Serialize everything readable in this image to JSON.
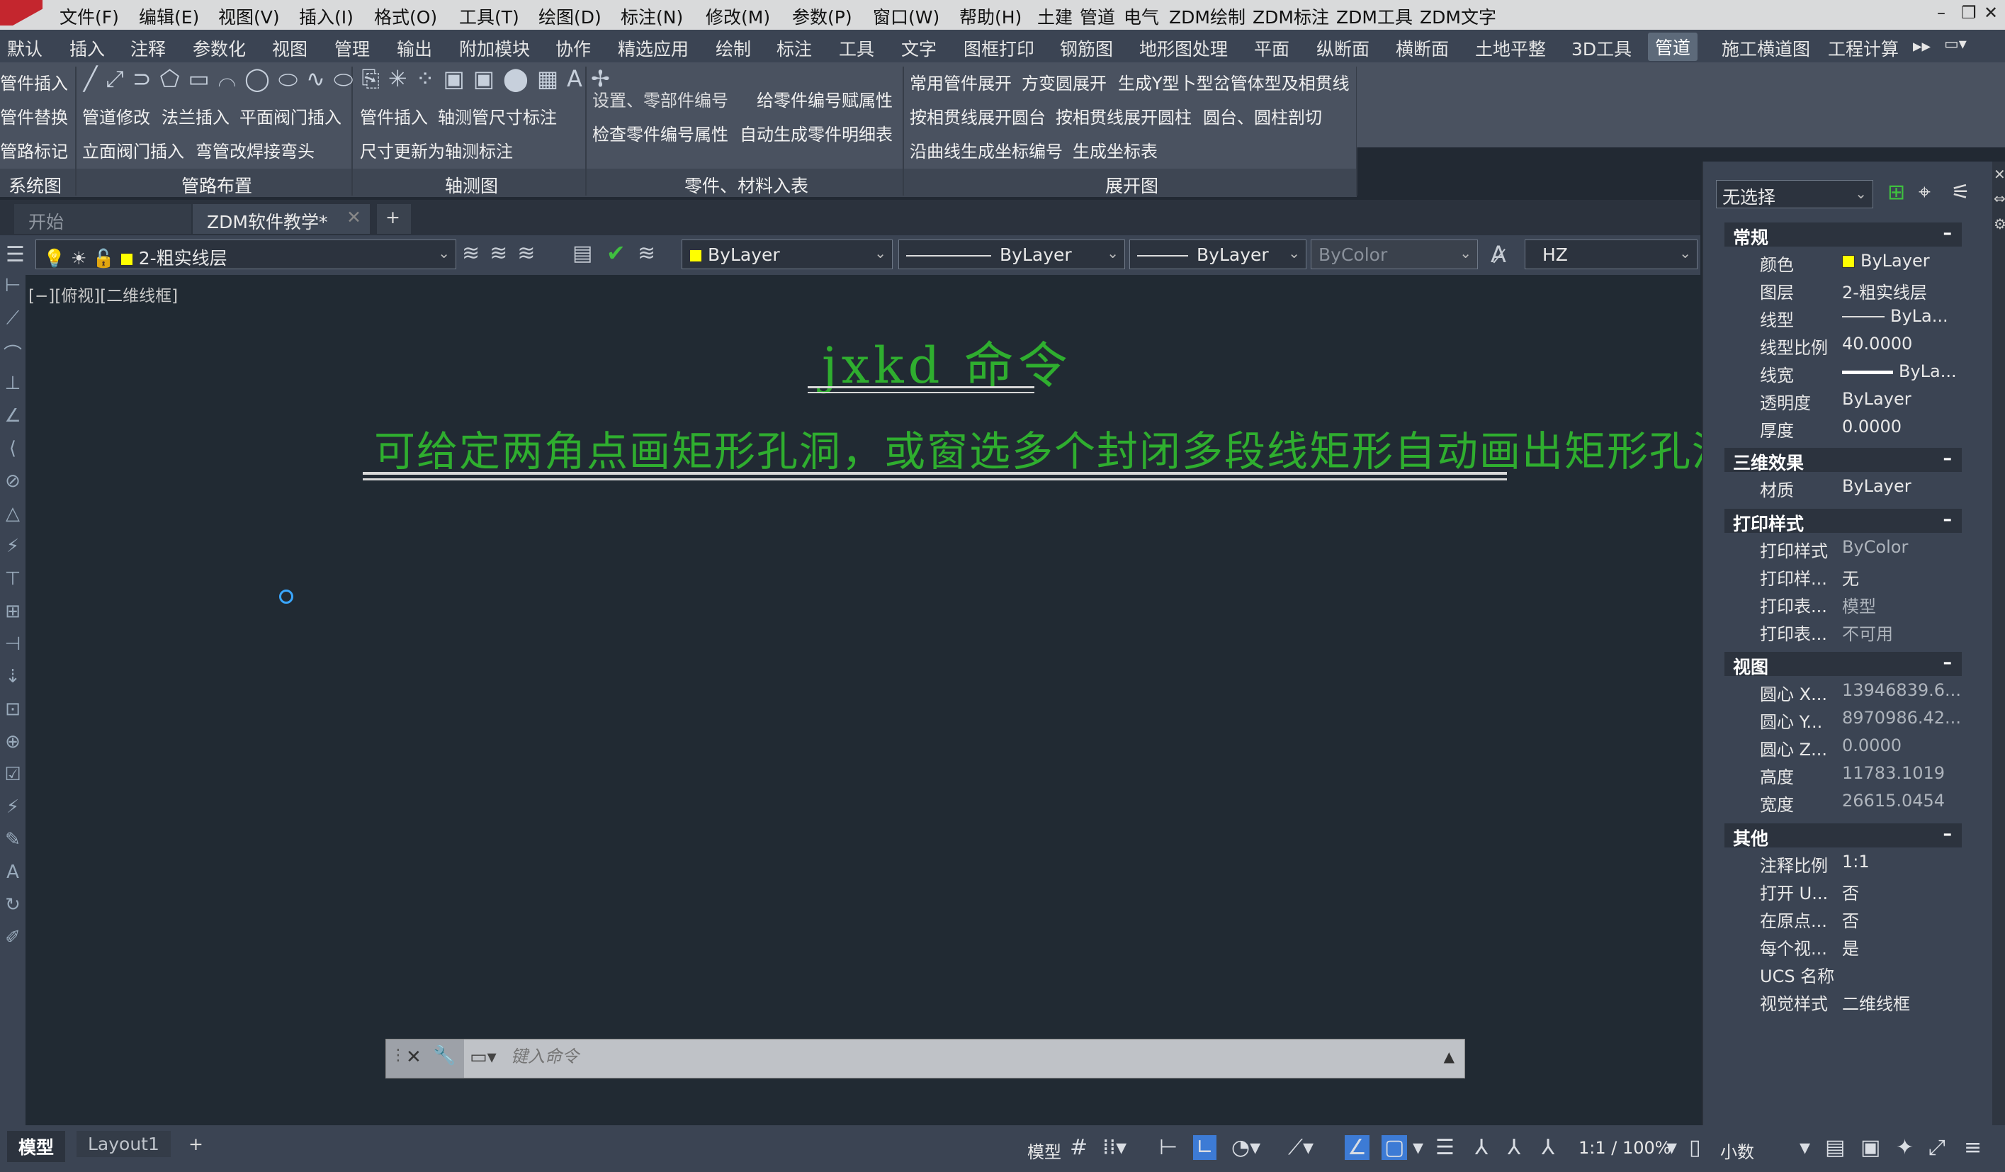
{
  "menubar": {
    "items": [
      "文件(F)",
      "编辑(E)",
      "视图(V)",
      "插入(I)",
      "格式(O)",
      "工具(T)",
      "绘图(D)",
      "标注(N)",
      "修改(M)",
      "参数(P)",
      "窗口(W)",
      "帮助(H)",
      "土建",
      "管道",
      "电气",
      "ZDM绘制",
      "ZDM标注",
      "ZDM工具",
      "ZDM文字"
    ],
    "window_controls": [
      "–",
      "❐",
      "✕"
    ]
  },
  "ribbon_tabs": {
    "items": [
      "默认",
      "插入",
      "注释",
      "参数化",
      "视图",
      "管理",
      "输出",
      "附加模块",
      "协作",
      "精选应用",
      "绘制",
      "标注",
      "工具",
      "文字",
      "图框打印",
      "钢筋图",
      "地形图处理",
      "平面",
      "纵断面",
      "横断面",
      "土地平整",
      "3D工具",
      "管道",
      "施工横道图",
      "工程计算"
    ],
    "active": "管道",
    "more": "▸▸"
  },
  "ribbon": {
    "panel1": {
      "rows": [
        "管件插入",
        "管件替换",
        "管路标记"
      ],
      "title": "系统图"
    },
    "panel2": {
      "rows": [
        "管道修改",
        "法兰插入",
        "平面阀门插入",
        "立面阀门插入",
        "弯管改焊接弯头"
      ],
      "title": "管路布置"
    },
    "panel3": {
      "rows": [
        "管件插入",
        "轴测管尺寸标注",
        "尺寸更新为轴测标注"
      ],
      "title": "轴测图"
    },
    "panel4": {
      "rows": [
        "设置、零部件编号",
        "给零件编号赋属性",
        "检查零件编号属性",
        "自动生成零件明细表"
      ],
      "title": "零件、材料入表"
    },
    "panel5": {
      "rows": [
        "常用管件展开",
        "方变圆展开",
        "生成Y型卜型岔管体型及相贯线",
        "按相贯线展开圆台",
        "按相贯线展开圆柱",
        "圆台、圆柱剖切",
        "沿曲线生成坐标编号",
        "生成坐标表"
      ],
      "title": "展开图"
    }
  },
  "doc_tabs": {
    "start": "开始",
    "active": "ZDM软件教学*",
    "add": "+"
  },
  "layer_toolbar": {
    "layer": "2-粗实线层",
    "color": "ByLayer",
    "linetype": "ByLayer",
    "lineweight": "ByLayer",
    "plotstyle": "ByColor",
    "textstyle": "HZ"
  },
  "viewport_label": "[−][俯视][二维线框]",
  "drawing": {
    "title": "jxkd  命令",
    "description": "可给定两角点画矩形孔洞，或窗选多个封闭多段线矩形自动画出矩形孔洞。"
  },
  "command_line": {
    "placeholder": "键入命令"
  },
  "properties": {
    "selection": "无选择",
    "sections": {
      "general": {
        "title": "常规",
        "rows": [
          [
            "颜色",
            "ByLayer"
          ],
          [
            "图层",
            "2-粗实线层"
          ],
          [
            "线型",
            "ByLa..."
          ],
          [
            "线型比例",
            "40.0000"
          ],
          [
            "线宽",
            "ByLa..."
          ],
          [
            "透明度",
            "ByLayer"
          ],
          [
            "厚度",
            "0.0000"
          ]
        ]
      },
      "3d": {
        "title": "三维效果",
        "rows": [
          [
            "材质",
            "ByLayer"
          ]
        ]
      },
      "plot": {
        "title": "打印样式",
        "rows": [
          [
            "打印样式",
            "ByColor"
          ],
          [
            "打印样...",
            "无"
          ],
          [
            "打印表...",
            "模型"
          ],
          [
            "打印表...",
            "不可用"
          ]
        ]
      },
      "view": {
        "title": "视图",
        "rows": [
          [
            "圆心 X...",
            "13946839.6..."
          ],
          [
            "圆心 Y...",
            "8970986.42..."
          ],
          [
            "圆心 Z...",
            "0.0000"
          ],
          [
            "高度",
            "11783.1019"
          ],
          [
            "宽度",
            "26615.0454"
          ]
        ]
      },
      "misc": {
        "title": "其他",
        "rows": [
          [
            "注释比例",
            "1:1"
          ],
          [
            "打开 U...",
            "否"
          ],
          [
            "在原点...",
            "否"
          ],
          [
            "每个视...",
            "是"
          ],
          [
            "UCS 名称",
            ""
          ],
          [
            "视觉样式",
            "二维线框"
          ]
        ]
      }
    }
  },
  "statusbar": {
    "model_tab": "模型",
    "layout_tab": "Layout1",
    "add": "+",
    "model_label": "模型",
    "scale": "1:1 / 100%",
    "units": "小数"
  },
  "colors": {
    "canvas": "#212a33",
    "accent_green": "#2fae2f",
    "panel": "#3b4453"
  }
}
